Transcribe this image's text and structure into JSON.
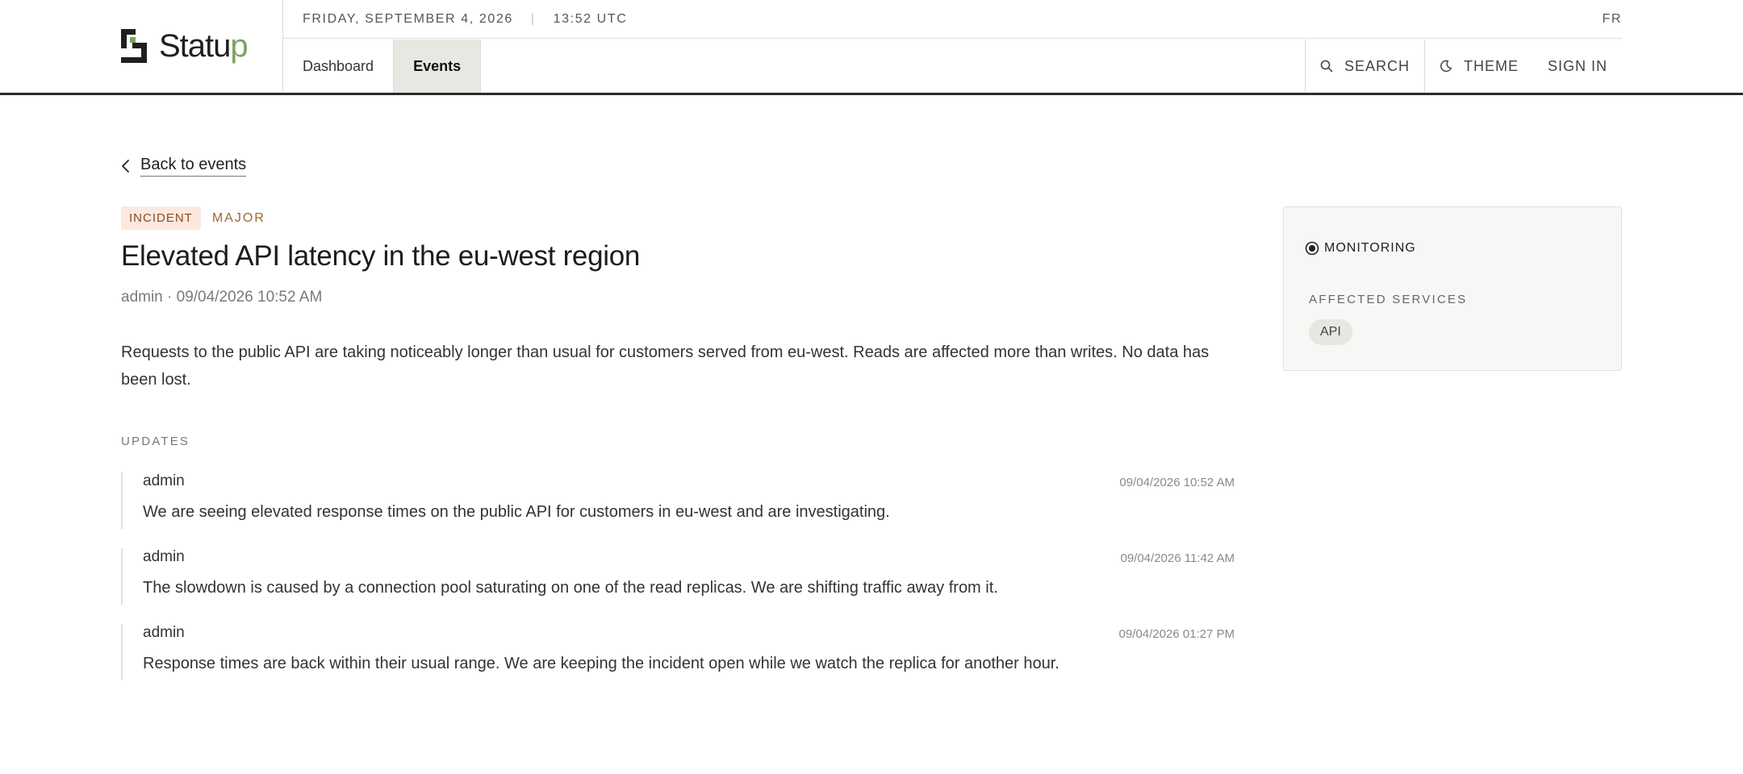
{
  "brand": {
    "name_main": "Statu",
    "name_accent": "p",
    "accent_color": "#7ea25b"
  },
  "topbar": {
    "date": "FRIDAY, SEPTEMBER 4, 2026",
    "time": "13:52 UTC",
    "language": "FR"
  },
  "nav": {
    "tabs": [
      {
        "label": "Dashboard",
        "active": false
      },
      {
        "label": "Events",
        "active": true
      }
    ]
  },
  "actions": {
    "search_label": "SEARCH",
    "search_icon": "search-icon",
    "theme_label": "THEME",
    "theme_icon": "moon-icon",
    "signin_label": "SIGN IN"
  },
  "back_link": {
    "label": "Back to events",
    "icon": "chevron-left-icon"
  },
  "event": {
    "type_tag": "INCIDENT",
    "severity": "MAJOR",
    "title": "Elevated API latency in the eu-west region",
    "meta": "admin · 09/04/2026 10:52 AM",
    "description": "Requests to the public API are taking noticeably longer than usual for customers served from eu-west. Reads are affected more than writes. No data has been lost."
  },
  "updates": {
    "label": "UPDATES",
    "items": [
      {
        "author": "admin",
        "time": "09/04/2026 10:52 AM",
        "text": "We are seeing elevated response times on the public API for customers in eu-west and are investigating."
      },
      {
        "author": "admin",
        "time": "09/04/2026 11:42 AM",
        "text": "The slowdown is caused by a connection pool saturating on one of the read replicas. We are shifting traffic away from it."
      },
      {
        "author": "admin",
        "time": "09/04/2026 01:27 PM",
        "text": "Response times are back within their usual range. We are keeping the incident open while we watch the replica for another hour."
      }
    ]
  },
  "panel": {
    "status": "MONITORING",
    "status_icon": "radio-dot-icon",
    "affected_label": "AFFECTED SERVICES",
    "services": [
      "API"
    ]
  }
}
